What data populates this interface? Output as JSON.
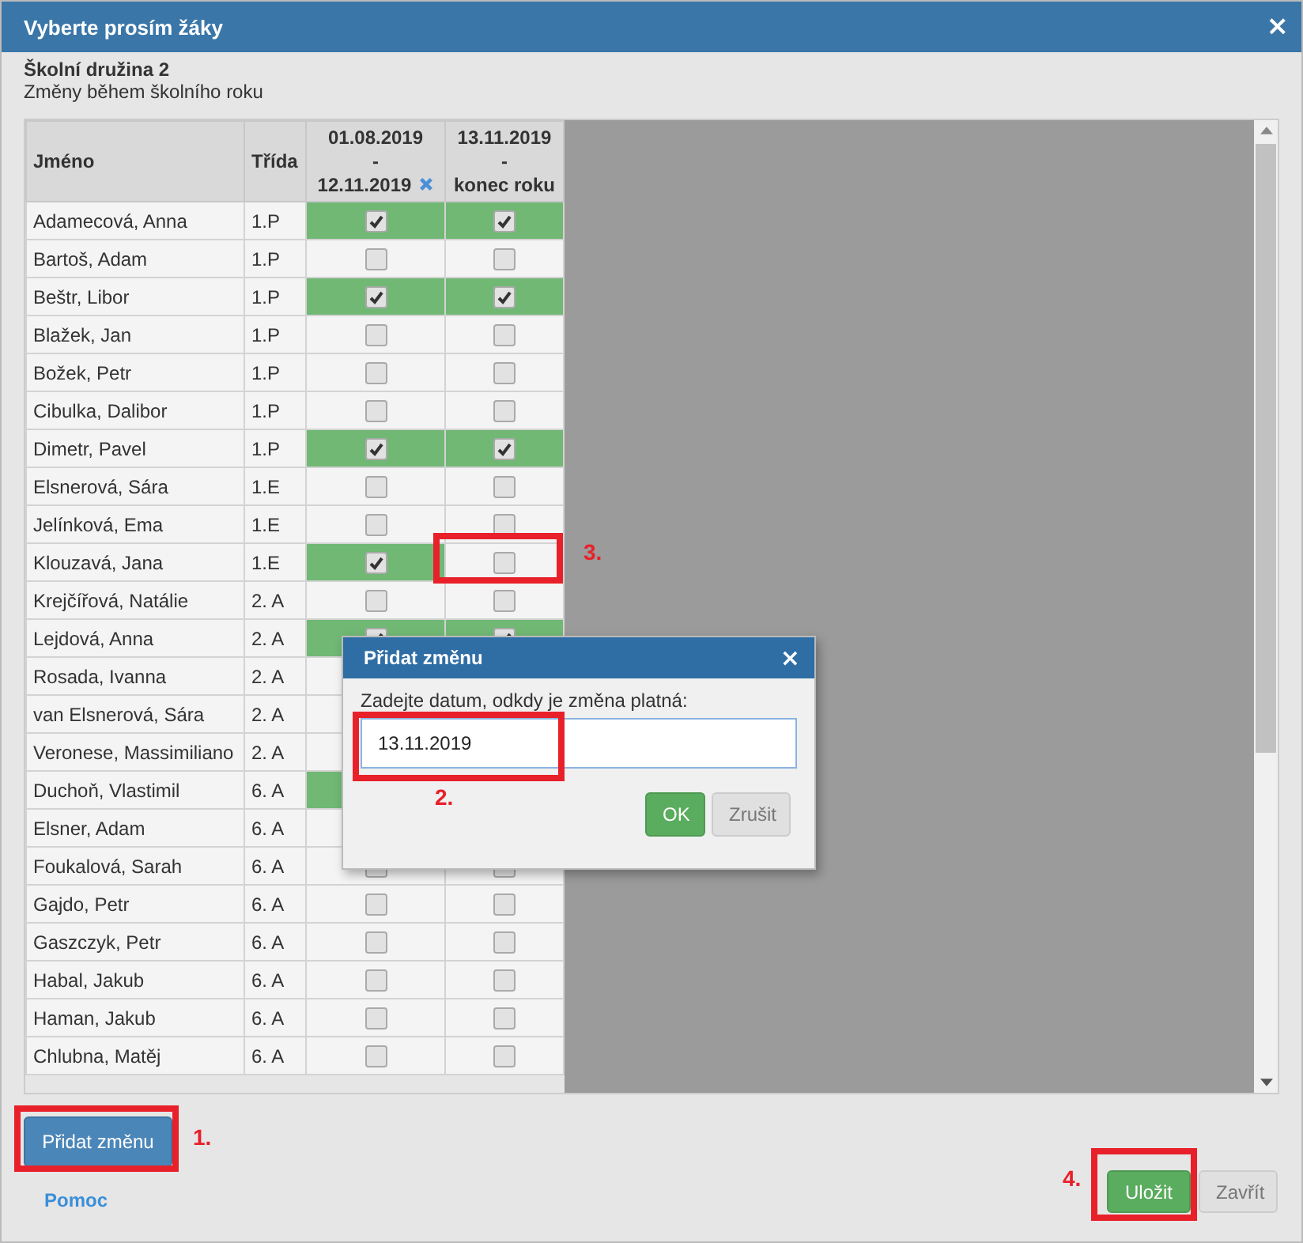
{
  "window": {
    "title": "Vyberte prosím žáky",
    "close": "×"
  },
  "group": {
    "title": "Školní družina 2",
    "subtitle": "Změny během školního roku"
  },
  "table": {
    "columns": [
      {
        "kind": "text",
        "lines": [
          "Jméno"
        ]
      },
      {
        "kind": "text",
        "lines": [
          "Třída"
        ]
      },
      {
        "kind": "period",
        "lines": [
          "01.08.2019",
          "-",
          "12.11.2019"
        ],
        "removable": true
      },
      {
        "kind": "period",
        "lines": [
          "13.11.2019",
          "-",
          "konec roku"
        ],
        "removable": false
      }
    ],
    "rows": [
      {
        "name": "Adamecová, Anna",
        "class": "1.P",
        "checks": [
          true,
          true
        ]
      },
      {
        "name": "Bartoš, Adam",
        "class": "1.P",
        "checks": [
          false,
          false
        ]
      },
      {
        "name": "Beštr, Libor",
        "class": "1.P",
        "checks": [
          true,
          true
        ]
      },
      {
        "name": "Blažek, Jan",
        "class": "1.P",
        "checks": [
          false,
          false
        ]
      },
      {
        "name": "Božek, Petr",
        "class": "1.P",
        "checks": [
          false,
          false
        ]
      },
      {
        "name": "Cibulka, Dalibor",
        "class": "1.P",
        "checks": [
          false,
          false
        ]
      },
      {
        "name": "Dimetr, Pavel",
        "class": "1.P",
        "checks": [
          true,
          true
        ]
      },
      {
        "name": "Elsnerová, Sára",
        "class": "1.E",
        "checks": [
          false,
          false
        ]
      },
      {
        "name": "Jelínková, Ema",
        "class": "1.E",
        "checks": [
          false,
          false
        ]
      },
      {
        "name": "Klouzavá, Jana",
        "class": "1.E",
        "checks": [
          true,
          false
        ]
      },
      {
        "name": "Krejčířová, Natálie",
        "class": "2. A",
        "checks": [
          false,
          false
        ]
      },
      {
        "name": "Lejdová, Anna",
        "class": "2. A",
        "checks": [
          true,
          true
        ]
      },
      {
        "name": "Rosada, Ivanna",
        "class": "2. A",
        "checks": [
          false
        ]
      },
      {
        "name": "van Elsnerová, Sára",
        "class": "2. A",
        "checks": [
          false
        ]
      },
      {
        "name": "Veronese, Massimiliano",
        "class": "2. A",
        "checks": [
          false
        ]
      },
      {
        "name": "Duchoň, Vlastimil",
        "class": "6. A",
        "checks": [
          true
        ]
      },
      {
        "name": "Elsner, Adam",
        "class": "6. A",
        "checks": [
          false
        ]
      },
      {
        "name": "Foukalová, Sarah",
        "class": "6. A",
        "checks": [
          false,
          false
        ]
      },
      {
        "name": "Gajdo, Petr",
        "class": "6. A",
        "checks": [
          false,
          false
        ]
      },
      {
        "name": "Gaszczyk, Petr",
        "class": "6. A",
        "checks": [
          false,
          false
        ]
      },
      {
        "name": "Habal, Jakub",
        "class": "6. A",
        "checks": [
          false,
          false
        ]
      },
      {
        "name": "Haman, Jakub",
        "class": "6. A",
        "checks": [
          false,
          false
        ]
      },
      {
        "name": "Chlubna, Matěj",
        "class": "6. A",
        "checks": [
          false,
          false
        ]
      }
    ]
  },
  "add_button": "Přidat změnu",
  "help_link": "Pomoc",
  "save_button": "Uložit",
  "close_button": "Zavřít",
  "modal": {
    "title": "Přidat změnu",
    "close": "×",
    "label": "Zadejte datum, odkdy je změna platná:",
    "value": "13.11.2019",
    "ok": "OK",
    "cancel": "Zrušit"
  },
  "annotations": [
    {
      "label": "1."
    },
    {
      "label": "2."
    },
    {
      "label": "3."
    },
    {
      "label": "4."
    }
  ]
}
